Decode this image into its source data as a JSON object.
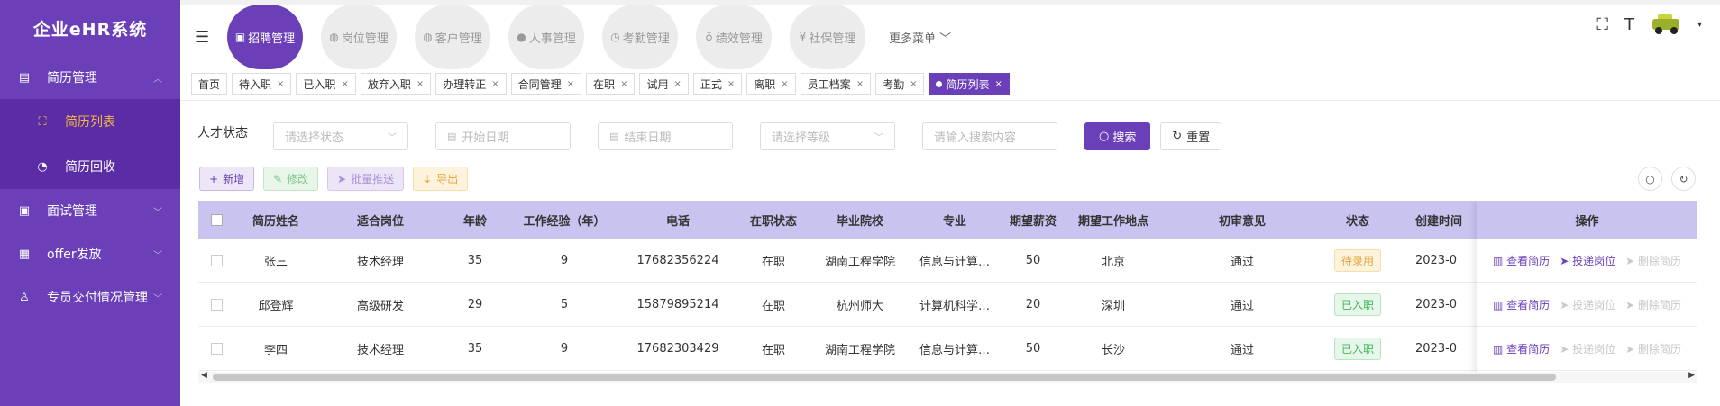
{
  "app": {
    "title": "企业eHR系统"
  },
  "sidebar": {
    "items": [
      {
        "label": "简历管理",
        "icon": "file-icon",
        "expanded": true,
        "children": [
          {
            "label": "简历列表",
            "icon": "scan-icon",
            "active": true
          },
          {
            "label": "简历回收",
            "icon": "recycle-icon",
            "active": false
          }
        ]
      },
      {
        "label": "面试管理",
        "icon": "print-icon"
      },
      {
        "label": "offer发放",
        "icon": "inbox-icon"
      },
      {
        "label": "专员交付情况管理",
        "icon": "person-icon"
      }
    ]
  },
  "topnav": {
    "modules": [
      {
        "label": "招聘管理",
        "icon": "clipboard-icon",
        "active": true
      },
      {
        "label": "岗位管理",
        "icon": "globe-icon"
      },
      {
        "label": "客户管理",
        "icon": "globe-icon"
      },
      {
        "label": "人事管理",
        "icon": "user-icon"
      },
      {
        "label": "考勤管理",
        "icon": "clock-icon"
      },
      {
        "label": "绩效管理",
        "icon": "chart-icon"
      },
      {
        "label": "社保管理",
        "icon": "yen-icon"
      }
    ],
    "more_label": "更多菜单"
  },
  "tags": [
    {
      "label": "首页",
      "closable": false
    },
    {
      "label": "待入职",
      "closable": true
    },
    {
      "label": "已入职",
      "closable": true
    },
    {
      "label": "放弃入职",
      "closable": true
    },
    {
      "label": "办理转正",
      "closable": true
    },
    {
      "label": "合同管理",
      "closable": true
    },
    {
      "label": "在职",
      "closable": true
    },
    {
      "label": "试用",
      "closable": true
    },
    {
      "label": "正式",
      "closable": true
    },
    {
      "label": "离职",
      "closable": true
    },
    {
      "label": "员工档案",
      "closable": true
    },
    {
      "label": "考勤",
      "closable": true
    },
    {
      "label": "简历列表",
      "closable": true,
      "active": true
    }
  ],
  "filters": {
    "label": "人才状态",
    "status_placeholder": "请选择状态",
    "start_placeholder": "开始日期",
    "end_placeholder": "结束日期",
    "level_placeholder": "请选择等级",
    "search_placeholder": "请输入搜索内容",
    "search_label": "搜索",
    "reset_label": "重置"
  },
  "actions": {
    "add": "新增",
    "edit": "修改",
    "batch": "批量推送",
    "export": "导出"
  },
  "table": {
    "headers": [
      "简历姓名",
      "适合岗位",
      "年龄",
      "工作经验（年）",
      "电话",
      "在职状态",
      "毕业院校",
      "专业",
      "期望薪资",
      "期望工作地点",
      "初审意见",
      "状态",
      "创建时间",
      "操作"
    ],
    "rows": [
      {
        "name": "张三",
        "position": "技术经理",
        "age": "35",
        "exp": "9",
        "phone": "17682356224",
        "job_status": "在职",
        "school": "湖南工程学院",
        "major": "信息与计算…",
        "salary": "50",
        "location": "北京",
        "review": "通过",
        "status": "待录用",
        "status_type": "wait",
        "created": "2023-0"
      },
      {
        "name": "邱登辉",
        "position": "高级研发",
        "age": "29",
        "exp": "5",
        "phone": "15879895214",
        "job_status": "在职",
        "school": "杭州师大",
        "major": "计算机科学…",
        "salary": "20",
        "location": "深圳",
        "review": "通过",
        "status": "已入职",
        "status_type": "in",
        "created": "2023-0"
      },
      {
        "name": "李四",
        "position": "技术经理",
        "age": "35",
        "exp": "9",
        "phone": "17682303429",
        "job_status": "在职",
        "school": "湖南工程学院",
        "major": "信息与计算…",
        "salary": "50",
        "location": "长沙",
        "review": "通过",
        "status": "已入职",
        "status_type": "in",
        "created": "2023-0"
      }
    ],
    "ops": {
      "view": "查看简历",
      "deliver": "投递岗位",
      "delete": "删除简历"
    }
  },
  "colors": {
    "primary": "#6a3fb8",
    "sidebar": "#6a3fb8",
    "submenu": "#5a2ca6",
    "header_row": "#c9c3f0",
    "active_sub": "#f5b642"
  }
}
